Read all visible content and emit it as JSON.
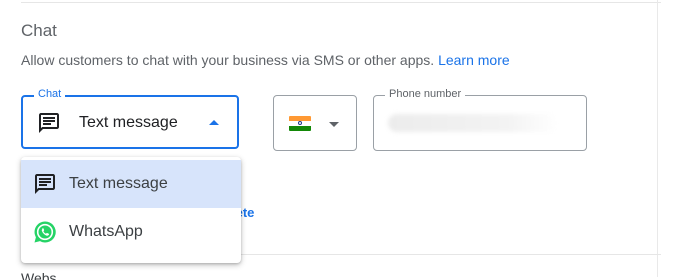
{
  "section": {
    "title": "Chat",
    "description": "Allow customers to chat with your business via SMS or other apps.",
    "learn_more": "Learn more"
  },
  "chat_select": {
    "label": "Chat",
    "value": "Text message",
    "icon": "message-icon",
    "accent_color": "#1a73e8"
  },
  "country_select": {
    "icon": "india-flag-icon"
  },
  "phone_field": {
    "label": "Phone number"
  },
  "delete_link": "lete",
  "dropdown": {
    "items": [
      {
        "label": "Text message",
        "icon": "message-icon",
        "selected": true
      },
      {
        "label": "WhatsApp",
        "icon": "whatsapp-icon",
        "selected": false
      }
    ]
  },
  "next_section_peek": "Webs"
}
